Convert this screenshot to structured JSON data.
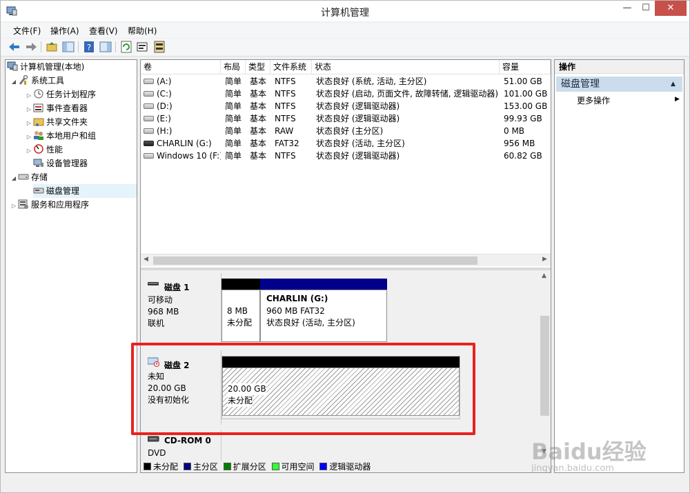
{
  "window": {
    "title": "计算机管理",
    "min": "—",
    "max": "☐",
    "close": "✕"
  },
  "menu": [
    "文件(F)",
    "操作(A)",
    "查看(V)",
    "帮助(H)"
  ],
  "tree": {
    "root": "计算机管理(本地)",
    "system_tools": "系统工具",
    "task_scheduler": "任务计划程序",
    "event_viewer": "事件查看器",
    "shared_folders": "共享文件夹",
    "local_users": "本地用户和组",
    "performance": "性能",
    "device_manager": "设备管理器",
    "storage": "存储",
    "disk_management": "磁盘管理",
    "services_apps": "服务和应用程序"
  },
  "columns": [
    "卷",
    "布局",
    "类型",
    "文件系统",
    "状态",
    "容量"
  ],
  "volumes": [
    [
      "(A:)",
      "简单",
      "基本",
      "NTFS",
      "状态良好 (系统, 活动, 主分区)",
      "51.00 GB"
    ],
    [
      "(C:)",
      "简单",
      "基本",
      "NTFS",
      "状态良好 (启动, 页面文件, 故障转储, 逻辑驱动器)",
      "101.00 GB"
    ],
    [
      "(D:)",
      "简单",
      "基本",
      "NTFS",
      "状态良好 (逻辑驱动器)",
      "153.00 GB"
    ],
    [
      "(E:)",
      "简单",
      "基本",
      "NTFS",
      "状态良好 (逻辑驱动器)",
      "99.93 GB"
    ],
    [
      "(H:)",
      "简单",
      "基本",
      "RAW",
      "状态良好 (主分区)",
      "0 MB"
    ],
    [
      "CHARLIN (G:)",
      "简单",
      "基本",
      "FAT32",
      "状态良好 (活动, 主分区)",
      "956 MB"
    ],
    [
      "Windows 10 (F:)",
      "简单",
      "基本",
      "NTFS",
      "状态良好 (逻辑驱动器)",
      "60.82 GB"
    ]
  ],
  "disk1": {
    "name": "磁盘 1",
    "type": "可移动",
    "size": "968 MB",
    "state": "联机",
    "unalloc_size": "8 MB",
    "unalloc_label": "未分配",
    "part_name": "CHARLIN  (G:)",
    "part_size": "960 MB FAT32",
    "part_status": "状态良好 (活动, 主分区)"
  },
  "disk2": {
    "name": "磁盘 2",
    "type": "未知",
    "size": "20.00 GB",
    "state": "没有初始化",
    "unalloc_size": "20.00 GB",
    "unalloc_label": "未分配"
  },
  "cdrom": {
    "name": "CD-ROM 0",
    "type": "DVD"
  },
  "legend": [
    "未分配",
    "主分区",
    "扩展分区",
    "可用空间",
    "逻辑驱动器"
  ],
  "legend_colors": [
    "#000000",
    "#000080",
    "#008000",
    "#33ff33",
    "#0000ff"
  ],
  "actions": {
    "header": "操作",
    "section": "磁盘管理",
    "more": "更多操作"
  },
  "watermark": {
    "brand": "Baidu经验",
    "url": "jingyan.baidu.com"
  }
}
